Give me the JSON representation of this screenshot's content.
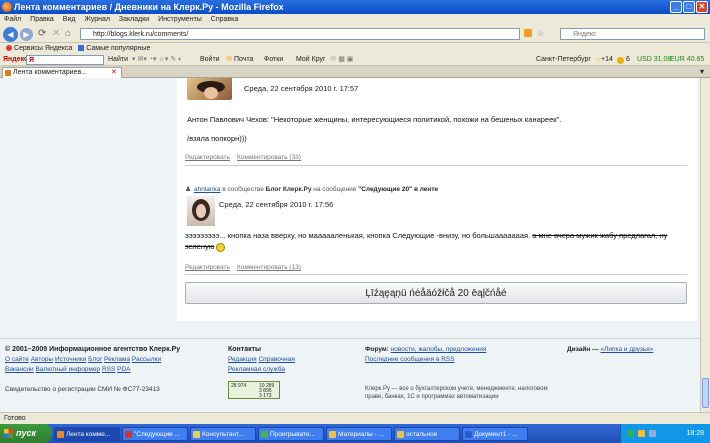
{
  "window": {
    "title": "Лента комментариев / Дневники на Клерк.Ру - Mozilla Firefox",
    "controls": {
      "minimize": "_",
      "maximize": "□",
      "close": "✕"
    }
  },
  "menu": [
    "Файл",
    "Правка",
    "Вид",
    "Журнал",
    "Закладки",
    "Инструменты",
    "Справка"
  ],
  "nav": {
    "url": "http://blogs.klerk.ru/comments/",
    "search_placeholder": "Яндекс"
  },
  "bookmarks": [
    "Сервисы Яндекса",
    "Самые популярные"
  ],
  "yandex_bar": {
    "logo": "Яндекс",
    "search_value": "Я",
    "find": "Найти",
    "login": "Войти",
    "mail": "Почта",
    "photos": "Фотки",
    "mykrug": "Мой Круг",
    "city": "Санкт-Петербург",
    "weather": "+14",
    "traffic": "6",
    "usd": "USD 31.08",
    "eur": "EUR 40.65"
  },
  "tabs": [
    {
      "label": "Лента комментариев..."
    }
  ],
  "comments": [
    {
      "date": "Среда, 22 сентября 2010 г. 17:57",
      "text": "Антон Павлович Чехов: \"Некоторые женщины, интересующиеся политикой, похожи на бешеных канареек\".",
      "text2": "/взяла попкорн)))",
      "edit": "Редактировать",
      "comment": "Комментировать (33)"
    },
    {
      "author": "ahnlanka",
      "in_community": "в сообществе",
      "community": "Блог Клерк.Ру",
      "to_post": "на сообщение",
      "post": "\"Следующие 20\" в ленте",
      "date": "Среда, 22 сентября 2010 г. 17:56",
      "text_plain": "эээээээээ... кнопка наза вверху, но маааааленькая, кнопка Следующие -внизу, но большааааааая.",
      "text_strike": "а мне вчера мужик жабу предлагал, ну зеленую",
      "edit": "Редактировать",
      "comment": "Комментировать (13)"
    }
  ],
  "next_button": "Ļīźąęąņü ńėåäóžłčå 20 ēąļčńåé",
  "footer": {
    "copyright": "© 2001–2009 Информационное агентство Клерк.Ру",
    "links_row1": [
      "О сайте",
      "Авторы",
      "Источники",
      "Блог",
      "Реклама",
      "Рассылки"
    ],
    "links_row2": [
      "Вакансии",
      "Валютный информер",
      "RSS",
      "PDA"
    ],
    "registration": "Свидетельство о регистрации СМИ № ФС77-23413",
    "contacts_title": "Контакты",
    "contacts": [
      "Редакция",
      "Справочная",
      "Рекламная служба"
    ],
    "forum_label": "Форум:",
    "forum_link": "новости, жалобы, предложения",
    "forum_last": "Последние сообщения в RSS",
    "design_label": "Дизайн —",
    "design_link": "«Липка и друзья»",
    "about": "Клерк.Ру — все о бухгалтерском учете, менеджменте, налоговом праве, банках, 1С и программах автоматизации",
    "counter": [
      "28 974",
      "10 289",
      "3 895",
      "3 173"
    ]
  },
  "status": "Готово",
  "taskbar": {
    "start": "пуск",
    "items": [
      "Лента комме...",
      "\"Следующие ...",
      "Консультант...",
      "Проигрывате...",
      "Материалы - ...",
      "остальное",
      "Документ1 - ..."
    ],
    "clock": "18:28"
  },
  "colors": {
    "titlebar": "#0b4cc7",
    "link": "#1f4e9e",
    "taskbar": "#1f4fb5"
  }
}
